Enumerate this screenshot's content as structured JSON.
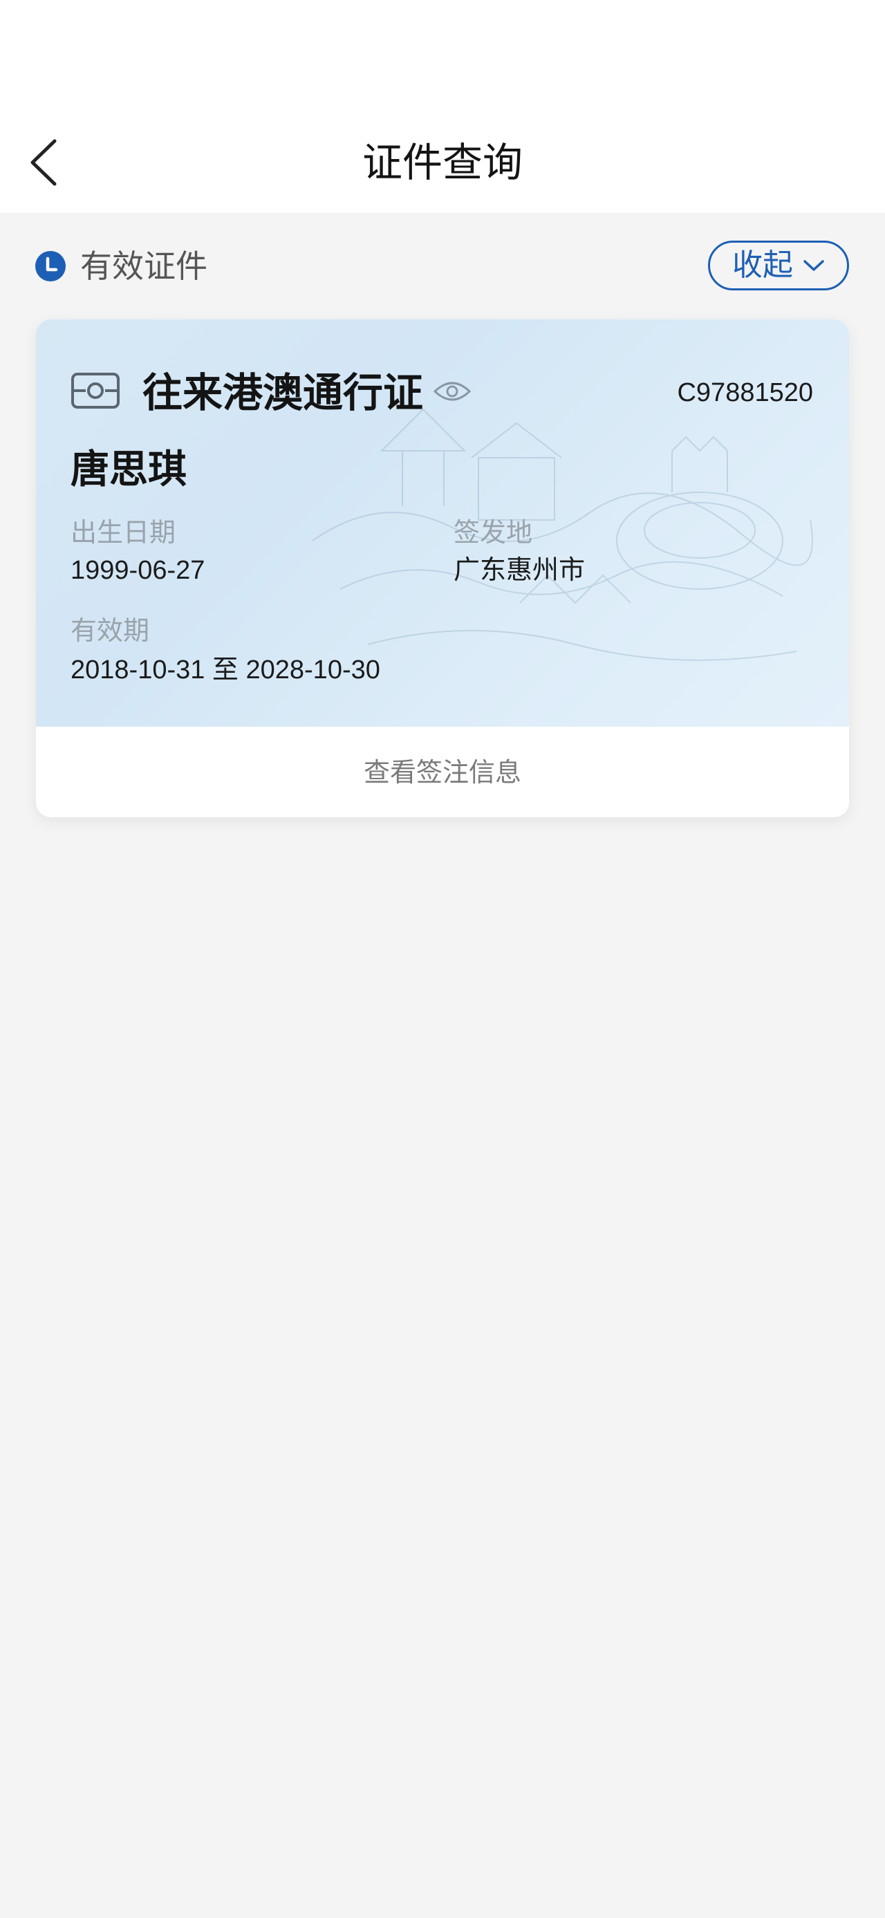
{
  "header": {
    "title": "证件查询",
    "back_icon": "chevron-left-icon"
  },
  "section": {
    "label": "有效证件",
    "status_icon": "clock-icon",
    "collapse_label": "收起",
    "collapse_icon": "chevron-down-icon",
    "accent_color": "#1d5fb4"
  },
  "card": {
    "type_icon": "id-card-icon",
    "type": "往来港澳通行证",
    "eye_icon": "eye-icon",
    "number": "C97881520",
    "holder_name": "唐思琪",
    "birth_label": "出生日期",
    "birth_value": "1999-06-27",
    "issue_place_label": "签发地",
    "issue_place_value": "广东惠州市",
    "validity_label": "有效期",
    "validity_value": "2018-10-31 至 2028-10-30",
    "footer_label": "查看签注信息"
  }
}
